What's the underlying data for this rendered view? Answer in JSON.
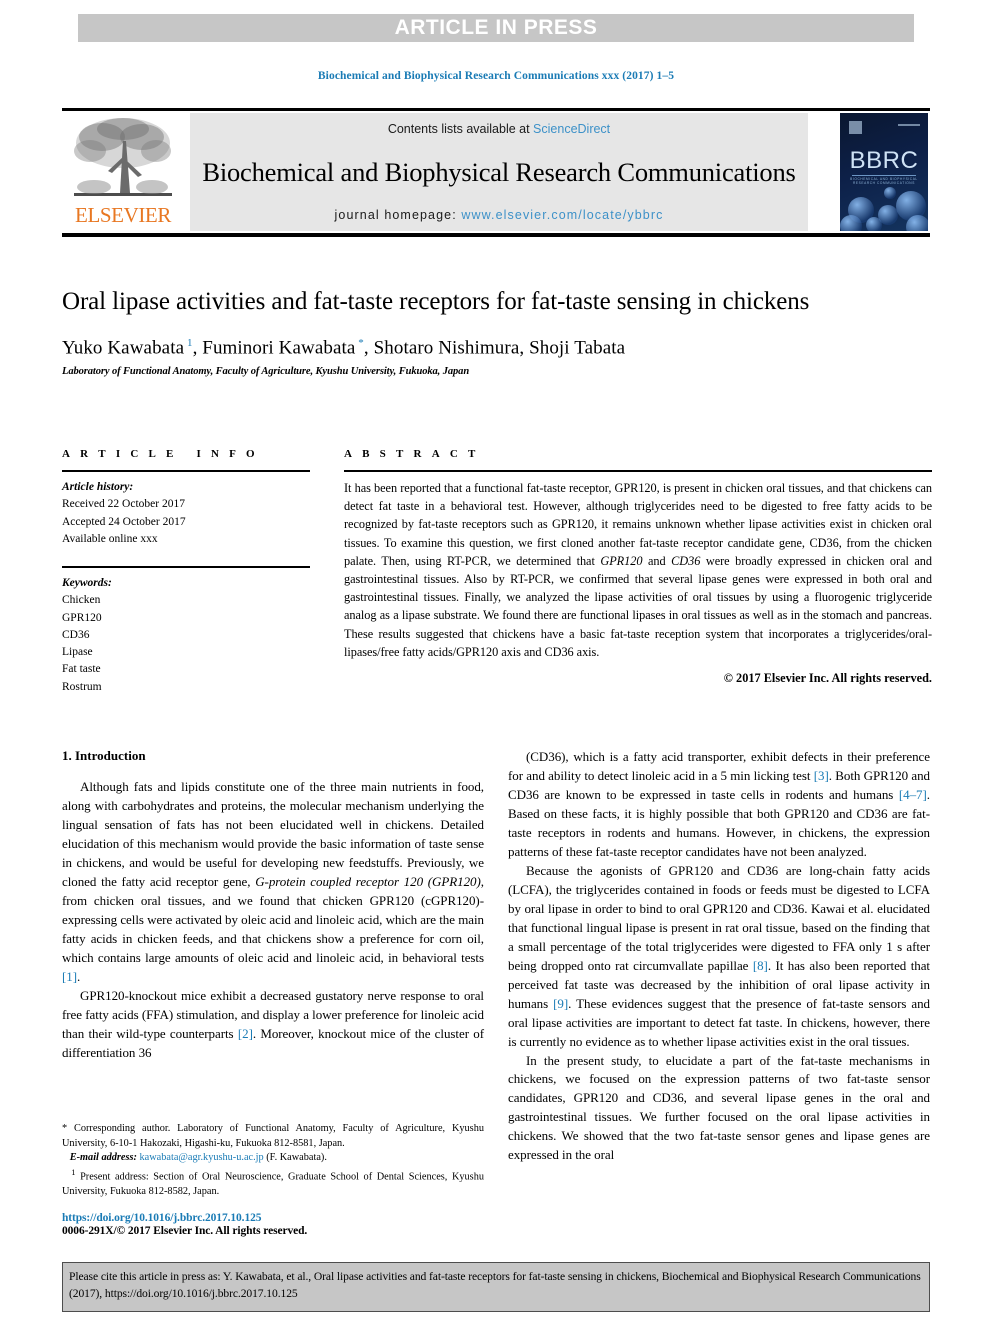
{
  "banner": {
    "text": "ARTICLE IN PRESS"
  },
  "running_head": "Biochemical and Biophysical Research Communications xxx (2017) 1–5",
  "masthead": {
    "contents_prefix": "Contents lists available at ",
    "sciencedirect": "ScienceDirect",
    "journal_title": "Biochemical and Biophysical Research Communications",
    "homepage_prefix": "journal homepage: ",
    "homepage_url": "www.elsevier.com/locate/ybbrc",
    "publisher_logo_text": "ELSEVIER",
    "cover_text": "BBRC",
    "cover_subtext": "BIOCHEMICAL AND BIOPHYSICAL RESEARCH COMMUNICATIONS"
  },
  "article": {
    "title": "Oral lipase activities and fat-taste receptors for fat-taste sensing in chickens",
    "authors": [
      {
        "name": "Yuko Kawabata",
        "mark": "1"
      },
      {
        "name": "Fuminori Kawabata",
        "mark": "*"
      },
      {
        "name": "Shotaro Nishimura",
        "mark": ""
      },
      {
        "name": "Shoji Tabata",
        "mark": ""
      }
    ],
    "affiliation": "Laboratory of Functional Anatomy, Faculty of Agriculture, Kyushu University, Fukuoka, Japan"
  },
  "article_info": {
    "heading": "ARTICLE INFO",
    "history_label": "Article history:",
    "history": [
      "Received 22 October 2017",
      "Accepted 24 October 2017",
      "Available online xxx"
    ],
    "keywords_label": "Keywords:",
    "keywords": [
      "Chicken",
      "GPR120",
      "CD36",
      "Lipase",
      "Fat taste",
      "Rostrum"
    ]
  },
  "abstract": {
    "heading": "ABSTRACT",
    "text_part1": "It has been reported that a functional fat-taste receptor, GPR120, is present in chicken oral tissues, and that chickens can detect fat taste in a behavioral test. However, although triglycerides need to be digested to free fatty acids to be recognized by fat-taste receptors such as GPR120, it remains unknown whether lipase activities exist in chicken oral tissues. To examine this question, we first cloned another fat-taste receptor candidate gene, CD36, from the chicken palate. Then, using RT-PCR, we determined that ",
    "italic1": "GPR120",
    "text_part2": " and ",
    "italic2": "CD36",
    "text_part3": " were broadly expressed in chicken oral and gastrointestinal tissues. Also by RT-PCR, we confirmed that several lipase genes were expressed in both oral and gastrointestinal tissues. Finally, we analyzed the lipase activities of oral tissues by using a fluorogenic triglyceride analog as a lipase substrate. We found there are functional lipases in oral tissues as well as in the stomach and pancreas. These results suggested that chickens have a basic fat-taste reception system that incorporates a triglycerides/oral-lipases/free fatty acids/GPR120 axis and CD36 axis.",
    "copyright": "© 2017 Elsevier Inc. All rights reserved."
  },
  "introduction": {
    "section_title": "1. Introduction",
    "left_paragraphs": [
      {
        "segments": [
          {
            "t": "Although fats and lipids constitute one of the three main nutrients in food, along with carbohydrates and proteins, the molecular mechanism underlying the lingual sensation of fats has not been elucidated well in chickens. Detailed elucidation of this mechanism would provide the basic information of taste sense in chickens, and would be useful for developing new feedstuffs. Previously, we cloned the fatty acid receptor gene, ",
            "s": "plain"
          },
          {
            "t": "G-protein coupled receptor 120 (GPR120)",
            "s": "italic"
          },
          {
            "t": ", from chicken oral tissues, and we found that chicken GPR120 (cGPR120)-expressing cells were activated by oleic acid and linoleic acid, which are the main fatty acids in chicken feeds, and that chickens show a preference for corn oil, which contains large amounts of oleic acid and linoleic acid, in behavioral tests ",
            "s": "plain"
          },
          {
            "t": "[1]",
            "s": "ref"
          },
          {
            "t": ".",
            "s": "plain"
          }
        ]
      },
      {
        "segments": [
          {
            "t": "GPR120-knockout mice exhibit a decreased gustatory nerve response to oral free fatty acids (FFA) stimulation, and display a lower preference for linoleic acid than their wild-type counterparts ",
            "s": "plain"
          },
          {
            "t": "[2]",
            "s": "ref"
          },
          {
            "t": ". Moreover, knockout mice of the cluster of differentiation 36",
            "s": "plain"
          }
        ]
      }
    ],
    "right_paragraphs": [
      {
        "segments": [
          {
            "t": "(CD36), which is a fatty acid transporter, exhibit defects in their preference for and ability to detect linoleic acid in a 5 min licking test ",
            "s": "plain"
          },
          {
            "t": "[3]",
            "s": "ref"
          },
          {
            "t": ". Both GPR120 and CD36 are known to be expressed in taste cells in rodents and humans ",
            "s": "plain"
          },
          {
            "t": "[4–7]",
            "s": "ref"
          },
          {
            "t": ". Based on these facts, it is highly possible that both GPR120 and CD36 are fat-taste receptors in rodents and humans. However, in chickens, the expression patterns of these fat-taste receptor candidates have not been analyzed.",
            "s": "plain"
          }
        ]
      },
      {
        "segments": [
          {
            "t": "Because the agonists of GPR120 and CD36 are long-chain fatty acids (LCFA), the triglycerides contained in foods or feeds must be digested to LCFA by oral lipase in order to bind to oral GPR120 and CD36. Kawai et al. elucidated that functional lingual lipase is present in rat oral tissue, based on the finding that a small percentage of the total triglycerides were digested to FFA only 1 s after being dropped onto rat circumvallate papillae ",
            "s": "plain"
          },
          {
            "t": "[8]",
            "s": "ref"
          },
          {
            "t": ". It has also been reported that perceived fat taste was decreased by the inhibition of oral lipase activity in humans ",
            "s": "plain"
          },
          {
            "t": "[9]",
            "s": "ref"
          },
          {
            "t": ". These evidences suggest that the presence of fat-taste sensors and oral lipase activities are important to detect fat taste. In chickens, however, there is currently no evidence as to whether lipase activities exist in the oral tissues.",
            "s": "plain"
          }
        ]
      },
      {
        "segments": [
          {
            "t": "In the present study, to elucidate a part of the fat-taste mechanisms in chickens, we focused on the expression patterns of two fat-taste sensor candidates, GPR120 and CD36, and several lipase genes in the oral and gastrointestinal tissues. We further focused on the oral lipase activities in chickens. We showed that the two fat-taste sensor genes and lipase genes are expressed in the oral",
            "s": "plain"
          }
        ]
      }
    ]
  },
  "footnotes": {
    "corresponding": "* Corresponding author. Laboratory of Functional Anatomy, Faculty of Agriculture, Kyushu University, 6-10-1 Hakozaki, Higashi-ku, Fukuoka 812-8581, Japan.",
    "email_label": "E-mail address:",
    "email": "kawabata@agr.kyushu-u.ac.jp",
    "email_suffix": "(F. Kawabata).",
    "present_address": "1 Present address: Section of Oral Neuroscience, Graduate School of Dental Sciences, Kyushu University, Fukuoka 812-8582, Japan.",
    "doi": "https://doi.org/10.1016/j.bbrc.2017.10.125",
    "issn": "0006-291X/© 2017 Elsevier Inc. All rights reserved."
  },
  "citation_footer": {
    "text": "Please cite this article in press as: Y. Kawabata, et al., Oral lipase activities and fat-taste receptors for fat-taste sensing in chickens, Biochemical and Biophysical Research Communications (2017), https://doi.org/10.1016/j.bbrc.2017.10.125"
  },
  "colors": {
    "link_blue": "#1a7bb5",
    "sciencedirect_blue": "#3d91c8",
    "elsevier_orange": "#e87722",
    "banner_gray": "#c6c6c6",
    "masthead_gray": "#e6e6e6"
  }
}
